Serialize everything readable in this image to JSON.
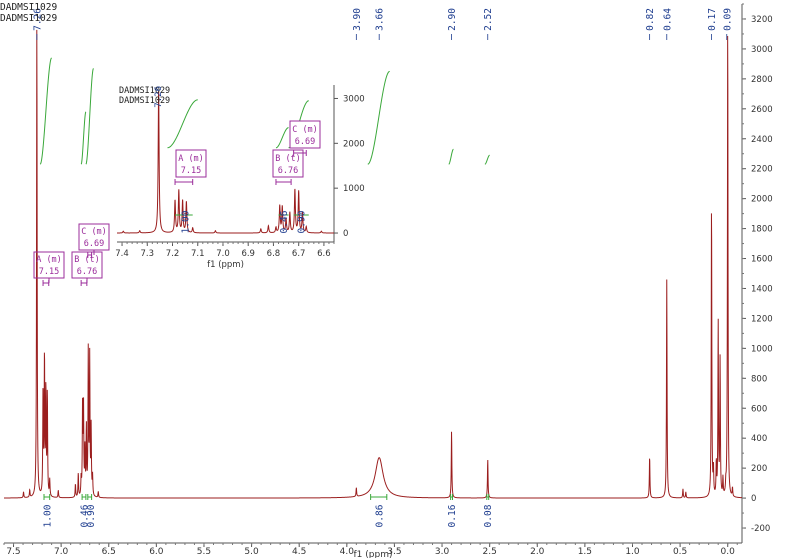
{
  "title_lines": [
    "DADMSI1029",
    "DADMSI1029"
  ],
  "chart_data": {
    "type": "line",
    "xlabel": "f1 (ppm)",
    "xlim": [
      7.6,
      -0.15
    ],
    "ylim": [
      -300,
      3300
    ],
    "x_ticks": [
      "7.5",
      "7.0",
      "6.5",
      "6.0",
      "5.5",
      "5.0",
      "4.5",
      "4.0",
      "3.5",
      "3.0",
      "2.5",
      "2.0",
      "1.5",
      "1.0",
      "0.5",
      "0.0"
    ],
    "y_ticks": [
      "-200",
      "0",
      "200",
      "400",
      "600",
      "800",
      "1000",
      "1200",
      "1400",
      "1600",
      "1800",
      "2000",
      "2200",
      "2400",
      "2600",
      "2800",
      "3000",
      "3200"
    ],
    "peak_labels": [
      "7.26",
      "3.90",
      "3.66",
      "2.90",
      "2.52",
      "0.82",
      "0.64",
      "0.17",
      "0.09"
    ],
    "multiplets": [
      {
        "label": "A (m)",
        "shift": "7.15"
      },
      {
        "label": "B (t)",
        "shift": "6.76"
      },
      {
        "label": "C (m)",
        "shift": "6.69"
      }
    ],
    "integrals": [
      {
        "x": 7.15,
        "value": "1.00"
      },
      {
        "x": 6.76,
        "value": "0.46"
      },
      {
        "x": 6.69,
        "value": "0.90"
      },
      {
        "x": 3.66,
        "value": "0.86"
      },
      {
        "x": 2.9,
        "value": "0.16"
      },
      {
        "x": 2.52,
        "value": "0.08"
      }
    ],
    "peaks": [
      {
        "x": 7.395,
        "h": 40
      },
      {
        "x": 7.33,
        "h": 50
      },
      {
        "x": 7.255,
        "h": 3200
      },
      {
        "x": 7.19,
        "h": 720
      },
      {
        "x": 7.175,
        "h": 940
      },
      {
        "x": 7.16,
        "h": 710
      },
      {
        "x": 7.145,
        "h": 690
      },
      {
        "x": 7.12,
        "h": 110
      },
      {
        "x": 7.03,
        "h": 50
      },
      {
        "x": 6.85,
        "h": 90
      },
      {
        "x": 6.82,
        "h": 160
      },
      {
        "x": 6.79,
        "h": 120
      },
      {
        "x": 6.775,
        "h": 600
      },
      {
        "x": 6.765,
        "h": 580
      },
      {
        "x": 6.75,
        "h": 300
      },
      {
        "x": 6.735,
        "h": 450
      },
      {
        "x": 6.715,
        "h": 960
      },
      {
        "x": 6.7,
        "h": 920
      },
      {
        "x": 6.685,
        "h": 450
      },
      {
        "x": 6.67,
        "h": 130
      },
      {
        "x": 6.61,
        "h": 40
      },
      {
        "x": 3.9,
        "h": 60
      },
      {
        "x": 2.9,
        "h": 450
      },
      {
        "x": 2.52,
        "h": 260
      },
      {
        "x": 0.82,
        "h": 280
      },
      {
        "x": 0.64,
        "h": 1460
      },
      {
        "x": 0.47,
        "h": 60
      },
      {
        "x": 0.44,
        "h": 40
      },
      {
        "x": 0.17,
        "h": 1980
      },
      {
        "x": 0.15,
        "h": 180
      },
      {
        "x": 0.12,
        "h": 220
      },
      {
        "x": 0.1,
        "h": 1160
      },
      {
        "x": 0.08,
        "h": 920
      },
      {
        "x": 0.05,
        "h": 120
      },
      {
        "x": 0.02,
        "h": 60
      },
      {
        "x": 0.0,
        "h": 3200
      },
      {
        "x": -0.05,
        "h": 60
      }
    ],
    "broad_peaks": [
      {
        "x": 3.66,
        "h": 270,
        "width": 0.05
      }
    ],
    "colors": {
      "spectrum": "#9b1e1e",
      "integral": "#3aa83a",
      "label": "#1e3d8f",
      "annotation": "#9b2d9b"
    },
    "inset": {
      "xlim": [
        7.42,
        6.56
      ],
      "ylim": [
        -200,
        3300
      ],
      "x_ticks": [
        "7.4",
        "7.3",
        "7.2",
        "7.1",
        "7.0",
        "6.9",
        "6.8",
        "6.7",
        "6.6"
      ],
      "y_ticks": [
        "0",
        "1000",
        "2000",
        "3000"
      ],
      "xlabel": "f1 (ppm)",
      "integral_labels": [
        "1.00",
        "0.46",
        "0.90"
      ]
    }
  }
}
